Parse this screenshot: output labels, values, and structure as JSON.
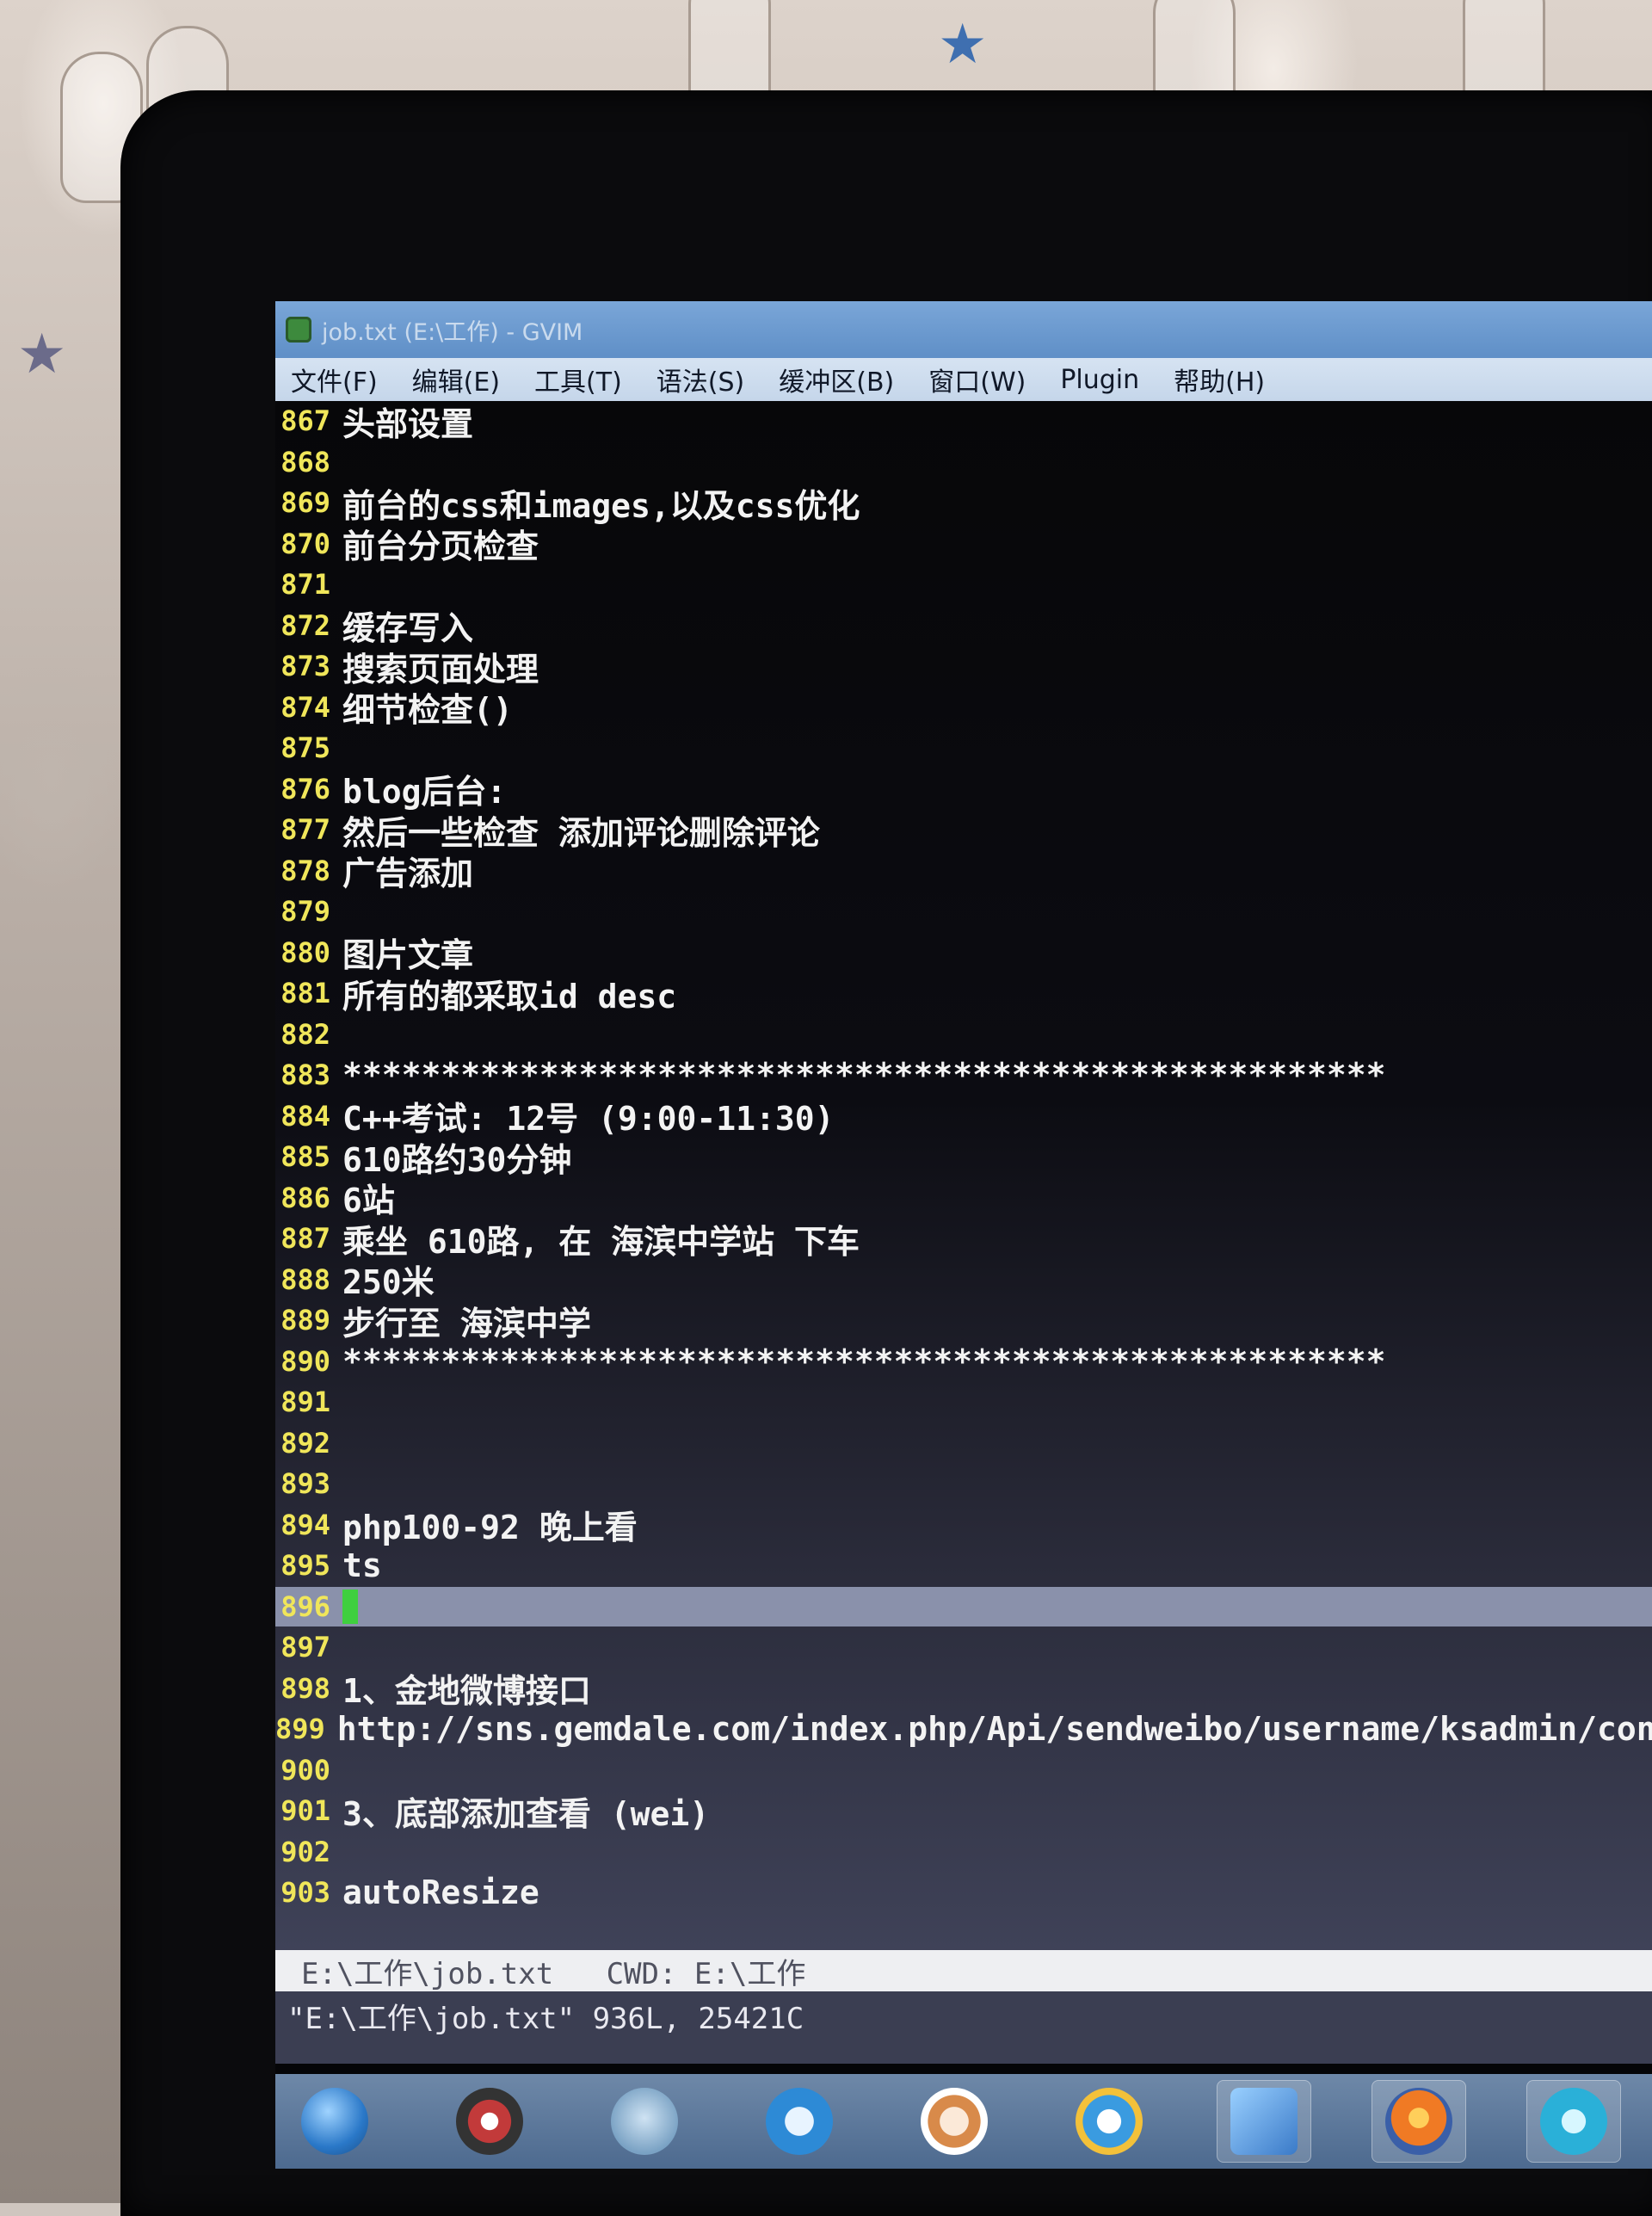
{
  "window": {
    "title": "job.txt (E:\\工作) - GVIM"
  },
  "menu": [
    "文件(F)",
    "编辑(E)",
    "工具(T)",
    "语法(S)",
    "缓冲区(B)",
    "窗口(W)",
    "Plugin",
    "帮助(H)"
  ],
  "editor": {
    "lines": [
      {
        "num": "867",
        "text": "头部设置"
      },
      {
        "num": "868",
        "text": ""
      },
      {
        "num": "869",
        "text": "前台的css和images,以及css优化"
      },
      {
        "num": "870",
        "text": "前台分页检查"
      },
      {
        "num": "871",
        "text": ""
      },
      {
        "num": "872",
        "text": "缓存写入"
      },
      {
        "num": "873",
        "text": "搜索页面处理"
      },
      {
        "num": "874",
        "text": "细节检查()"
      },
      {
        "num": "875",
        "text": ""
      },
      {
        "num": "876",
        "text": "blog后台:"
      },
      {
        "num": "877",
        "text": "然后一些检查 添加评论删除评论"
      },
      {
        "num": "878",
        "text": "广告添加"
      },
      {
        "num": "879",
        "text": ""
      },
      {
        "num": "880",
        "text": "图片文章"
      },
      {
        "num": "881",
        "text": "所有的都采取id desc"
      },
      {
        "num": "882",
        "text": ""
      },
      {
        "num": "883",
        "text": "*****************************************************"
      },
      {
        "num": "884",
        "text": "C++考试: 12号 (9:00-11:30)"
      },
      {
        "num": "885",
        "text": "610路约30分钟"
      },
      {
        "num": "886",
        "text": "6站"
      },
      {
        "num": "887",
        "text": "乘坐 610路, 在 海滨中学站 下车"
      },
      {
        "num": "888",
        "text": "250米"
      },
      {
        "num": "889",
        "text": "步行至 海滨中学"
      },
      {
        "num": "890",
        "text": "*****************************************************"
      },
      {
        "num": "891",
        "text": ""
      },
      {
        "num": "892",
        "text": ""
      },
      {
        "num": "893",
        "text": ""
      },
      {
        "num": "894",
        "text": "php100-92 晚上看"
      },
      {
        "num": "895",
        "text": "ts"
      },
      {
        "num": "896",
        "text": "",
        "cursor": true
      },
      {
        "num": "897",
        "text": ""
      },
      {
        "num": "898",
        "text": "1、金地微博接口"
      },
      {
        "num": "899",
        "text": "http://sns.gemdale.com/index.php/Api/sendweibo/username/ksadmin/con"
      },
      {
        "num": "900",
        "text": ""
      },
      {
        "num": "901",
        "text": "3、底部添加查看 (wei)"
      },
      {
        "num": "902",
        "text": ""
      },
      {
        "num": "903",
        "text": "autoResize"
      }
    ]
  },
  "statusline": {
    "text": "E:\\工作\\job.txt   CWD: E:\\工作"
  },
  "cmdline": {
    "text": "\"E:\\工作\\job.txt\" 936L, 25421C"
  },
  "taskbar": {
    "icons": [
      "windows-start-icon",
      "media-player-icon",
      "qt-icon",
      "teamviewer-icon",
      "search-tool-icon",
      "internet-explorer-icon",
      "control-panel-icon",
      "firefox-icon",
      "network-icon"
    ]
  },
  "colors": {
    "line_number": "#f0e65a",
    "text": "#f3f3f3",
    "cursor": "#3fcf3f",
    "cursorline": "#8a91ab",
    "titlebar": "#6b97cd"
  }
}
